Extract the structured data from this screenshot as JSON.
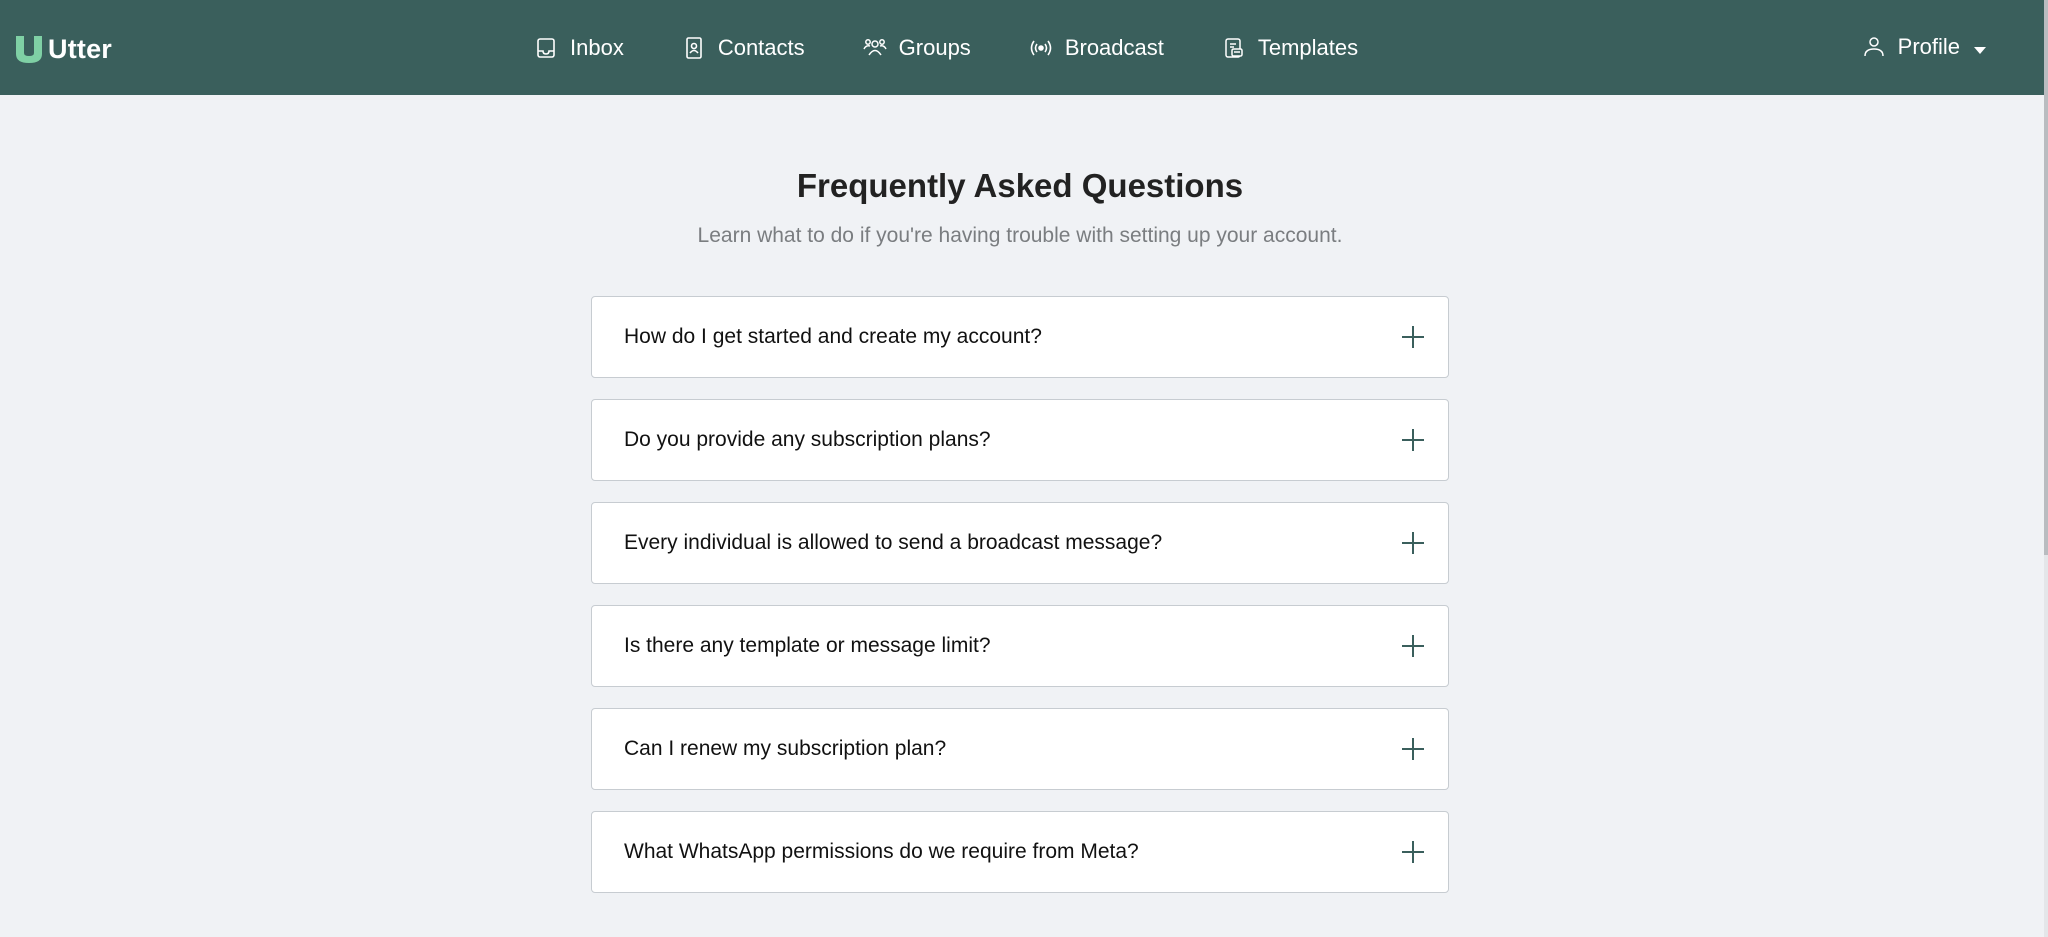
{
  "app": {
    "name": "Utter",
    "brand_color": "#3a5f5c",
    "logo_accent": "#7fd0a5"
  },
  "nav": {
    "items": [
      {
        "label": "Inbox",
        "icon": "inbox-icon"
      },
      {
        "label": "Contacts",
        "icon": "contact-card-icon"
      },
      {
        "label": "Groups",
        "icon": "users-group-icon"
      },
      {
        "label": "Broadcast",
        "icon": "broadcast-icon"
      },
      {
        "label": "Templates",
        "icon": "templates-icon"
      }
    ],
    "profile": {
      "label": "Profile",
      "icon": "user-icon"
    }
  },
  "faq": {
    "title": "Frequently Asked Questions",
    "subtitle": "Learn what to do if you're having trouble with setting up your account.",
    "items": [
      {
        "question": "How do I get started and create my account?"
      },
      {
        "question": "Do you provide any subscription plans?"
      },
      {
        "question": "Every individual is allowed to send a broadcast message?"
      },
      {
        "question": "Is there any template or message limit?"
      },
      {
        "question": "Can I renew my subscription plan?"
      },
      {
        "question": "What WhatsApp permissions do we require from Meta?"
      }
    ]
  }
}
